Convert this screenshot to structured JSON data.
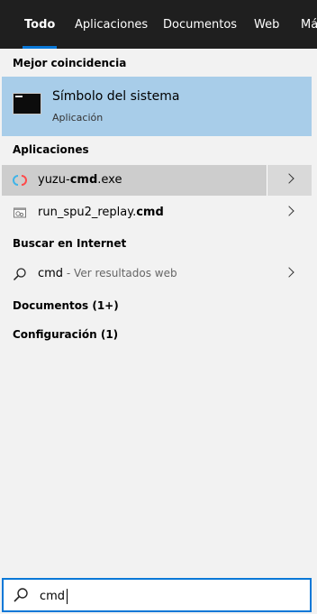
{
  "tabs": [
    {
      "label": "Todo",
      "active": true
    },
    {
      "label": "Aplicaciones"
    },
    {
      "label": "Documentos"
    },
    {
      "label": "Web"
    },
    {
      "label": "Má"
    }
  ],
  "best_match": {
    "header": "Mejor coincidencia",
    "title": "Símbolo del sistema",
    "subtitle": "Aplicación",
    "icon": "command-prompt-icon"
  },
  "apps_section": {
    "header": "Aplicaciones",
    "items": [
      {
        "prefix": "yuzu-",
        "bold": "cmd",
        "suffix": ".exe",
        "icon": "yuzu-icon"
      },
      {
        "prefix": "run_spu2_replay.",
        "bold": "cmd",
        "suffix": "",
        "icon": "script-file-icon"
      }
    ]
  },
  "web_section": {
    "header": "Buscar en Internet",
    "query": "cmd",
    "hint": " - Ver resultados web",
    "icon": "search-icon"
  },
  "documents_header": "Documentos (1+)",
  "settings_header": "Configuración (1)",
  "search": {
    "value": "cmd",
    "icon": "search-icon"
  },
  "colors": {
    "accent": "#0a78d7",
    "best_bg": "#a8cde9",
    "tabbar_bg": "#1f1f1f"
  }
}
